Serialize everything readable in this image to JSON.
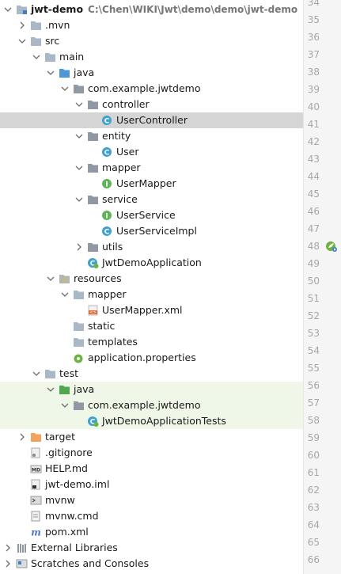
{
  "project": {
    "name": "jwt-demo",
    "path": "C:\\Chen\\WIKI\\Jwt\\demo\\demo\\jwt-demo"
  },
  "tree": [
    {
      "label": "jwt-demo",
      "level": 0,
      "arrow": "open",
      "icon": "folder-module-icon",
      "bold": true
    },
    {
      "label": ".mvn",
      "level": 1,
      "arrow": "closed",
      "icon": "folder-icon"
    },
    {
      "label": "src",
      "level": 1,
      "arrow": "open",
      "icon": "folder-icon"
    },
    {
      "label": "main",
      "level": 2,
      "arrow": "open",
      "icon": "folder-icon"
    },
    {
      "label": "java",
      "level": 3,
      "arrow": "open",
      "icon": "source-folder-icon"
    },
    {
      "label": "com.example.jwtdemo",
      "level": 4,
      "arrow": "open",
      "icon": "package-icon"
    },
    {
      "label": "controller",
      "level": 5,
      "arrow": "open",
      "icon": "package-icon"
    },
    {
      "label": "UserController",
      "level": 6,
      "arrow": "none",
      "icon": "class-icon",
      "selected": true
    },
    {
      "label": "entity",
      "level": 5,
      "arrow": "open",
      "icon": "package-icon"
    },
    {
      "label": "User",
      "level": 6,
      "arrow": "none",
      "icon": "class-icon"
    },
    {
      "label": "mapper",
      "level": 5,
      "arrow": "open",
      "icon": "package-icon"
    },
    {
      "label": "UserMapper",
      "level": 6,
      "arrow": "none",
      "icon": "interface-icon"
    },
    {
      "label": "service",
      "level": 5,
      "arrow": "open",
      "icon": "package-icon"
    },
    {
      "label": "UserService",
      "level": 6,
      "arrow": "none",
      "icon": "interface-icon"
    },
    {
      "label": "UserServiceImpl",
      "level": 6,
      "arrow": "none",
      "icon": "class-icon"
    },
    {
      "label": "utils",
      "level": 5,
      "arrow": "closed",
      "icon": "package-icon"
    },
    {
      "label": "JwtDemoApplication",
      "level": 5,
      "arrow": "none",
      "icon": "spring-app-icon"
    },
    {
      "label": "resources",
      "level": 3,
      "arrow": "open",
      "icon": "resources-folder-icon"
    },
    {
      "label": "mapper",
      "level": 4,
      "arrow": "open",
      "icon": "folder-icon"
    },
    {
      "label": "UserMapper.xml",
      "level": 5,
      "arrow": "none",
      "icon": "xml-file-icon"
    },
    {
      "label": "static",
      "level": 4,
      "arrow": "none",
      "icon": "folder-icon"
    },
    {
      "label": "templates",
      "level": 4,
      "arrow": "none",
      "icon": "folder-icon"
    },
    {
      "label": "application.properties",
      "level": 4,
      "arrow": "none",
      "icon": "properties-file-icon"
    },
    {
      "label": "test",
      "level": 2,
      "arrow": "open",
      "icon": "folder-icon"
    },
    {
      "label": "java",
      "level": 3,
      "arrow": "open",
      "icon": "test-folder-icon",
      "green": true
    },
    {
      "label": "com.example.jwtdemo",
      "level": 4,
      "arrow": "open",
      "icon": "package-icon",
      "green": true
    },
    {
      "label": "JwtDemoApplicationTests",
      "level": 5,
      "arrow": "none",
      "icon": "spring-app-icon",
      "green": true
    },
    {
      "label": "target",
      "level": 1,
      "arrow": "closed",
      "icon": "excluded-folder-icon"
    },
    {
      "label": ".gitignore",
      "level": 1,
      "arrow": "none",
      "icon": "gitignore-file-icon"
    },
    {
      "label": "HELP.md",
      "level": 1,
      "arrow": "none",
      "icon": "markdown-file-icon"
    },
    {
      "label": "jwt-demo.iml",
      "level": 1,
      "arrow": "none",
      "icon": "iml-file-icon"
    },
    {
      "label": "mvnw",
      "level": 1,
      "arrow": "none",
      "icon": "script-file-icon"
    },
    {
      "label": "mvnw.cmd",
      "level": 1,
      "arrow": "none",
      "icon": "text-file-icon"
    },
    {
      "label": "pom.xml",
      "level": 1,
      "arrow": "none",
      "icon": "maven-file-icon"
    },
    {
      "label": "External Libraries",
      "level": 0,
      "arrow": "closed",
      "icon": "libraries-icon"
    },
    {
      "label": "Scratches and Consoles",
      "level": 0,
      "arrow": "closed",
      "icon": "scratches-icon"
    }
  ],
  "line_numbers": [
    "34",
    "35",
    "36",
    "37",
    "38",
    "39",
    "40",
    "41",
    "42",
    "43",
    "44",
    "45",
    "46",
    "47",
    "48",
    "49",
    "50",
    "51",
    "52",
    "53",
    "54",
    "55",
    "56",
    "57",
    "58",
    "59",
    "60",
    "61",
    "62",
    "63",
    "64",
    "65",
    "66"
  ],
  "gutter_marker_line": "48",
  "colors": {
    "selection": "#d5d5d5",
    "test_highlight": "#eef7e8",
    "folder": "#a9b7c6",
    "source_folder": "#4e97d6",
    "test_folder": "#4fa84d",
    "excluded_folder": "#f2a35e",
    "class": "#40a0cf",
    "interface": "#5fb45a",
    "package": "#8f98a3"
  }
}
